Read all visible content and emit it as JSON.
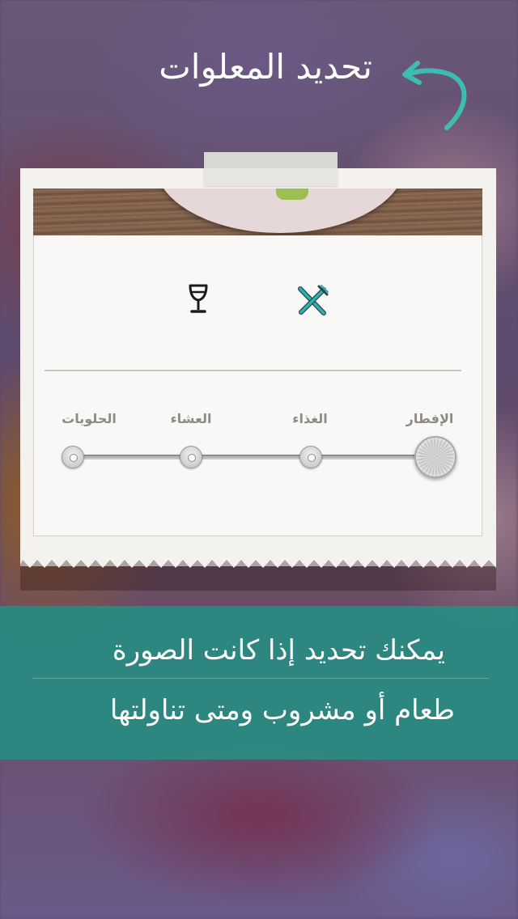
{
  "header": {
    "title": "تحديد المعلوات"
  },
  "categories": {
    "food_icon": "fork-knife-icon",
    "drink_icon": "wine-glass-icon",
    "selected": "food"
  },
  "meal_slider": {
    "stops": [
      "الإفطار",
      "الغذاء",
      "العشاء",
      "الحلويات"
    ],
    "selected_index": 0
  },
  "banner": {
    "line1": "يمكنك تحديد إذا كانت الصورة",
    "line2": "طعام أو مشروب ومتى تناولتها"
  },
  "colors": {
    "accent": "#2fb3a6",
    "banner": "#288c82"
  }
}
